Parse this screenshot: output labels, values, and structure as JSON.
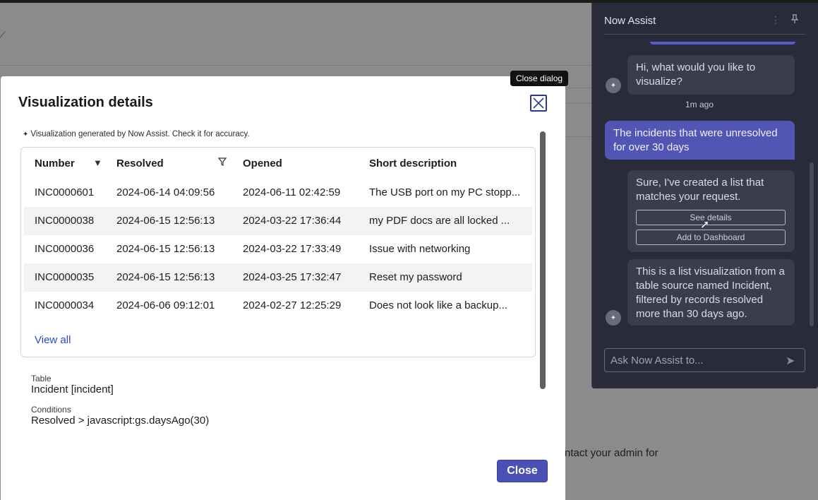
{
  "background": {
    "contact_text": "ntact your admin for"
  },
  "dialog": {
    "title": "Visualization details",
    "close_tooltip": "Close dialog",
    "ai_note": "Visualization generated by Now Assist. Check it for accuracy.",
    "table": {
      "headers": [
        "Number",
        "Resolved",
        "Opened",
        "Short description"
      ],
      "rows": [
        [
          "INC0000601",
          "2024-06-14 04:09:56",
          "2024-06-11 02:42:59",
          "The USB port on my PC stopp..."
        ],
        [
          "INC0000038",
          "2024-06-15 12:56:13",
          "2024-03-22 17:36:44",
          "my PDF docs are all locked ..."
        ],
        [
          "INC0000036",
          "2024-06-15 12:56:13",
          "2024-03-22 17:33:49",
          "Issue with networking"
        ],
        [
          "INC0000035",
          "2024-06-15 12:56:13",
          "2024-03-25 17:32:47",
          "Reset my password"
        ],
        [
          "INC0000034",
          "2024-06-06 09:12:01",
          "2024-02-27 12:25:29",
          "Does not look like a backup..."
        ]
      ],
      "view_all": "View all"
    },
    "meta": {
      "table_label": "Table",
      "table_value": "Incident [incident]",
      "conditions_label": "Conditions",
      "conditions_value": "Resolved > javascript:gs.daysAgo(30)"
    },
    "close_button": "Close"
  },
  "assist": {
    "title": "Now Assist",
    "messages": {
      "bot1": "Hi, what would you like to visualize?",
      "timestamp": "1m ago",
      "user1": "The incidents that were unresolved for over 30 days",
      "bot2": "Sure, I've created a list that matches your request.",
      "see_details": "See details",
      "add_dashboard": "Add to Dashboard",
      "bot3": "This is a list visualization from a table source named Incident, filtered by records resolved more than 30 days ago."
    },
    "input_placeholder": "Ask Now Assist to..."
  }
}
